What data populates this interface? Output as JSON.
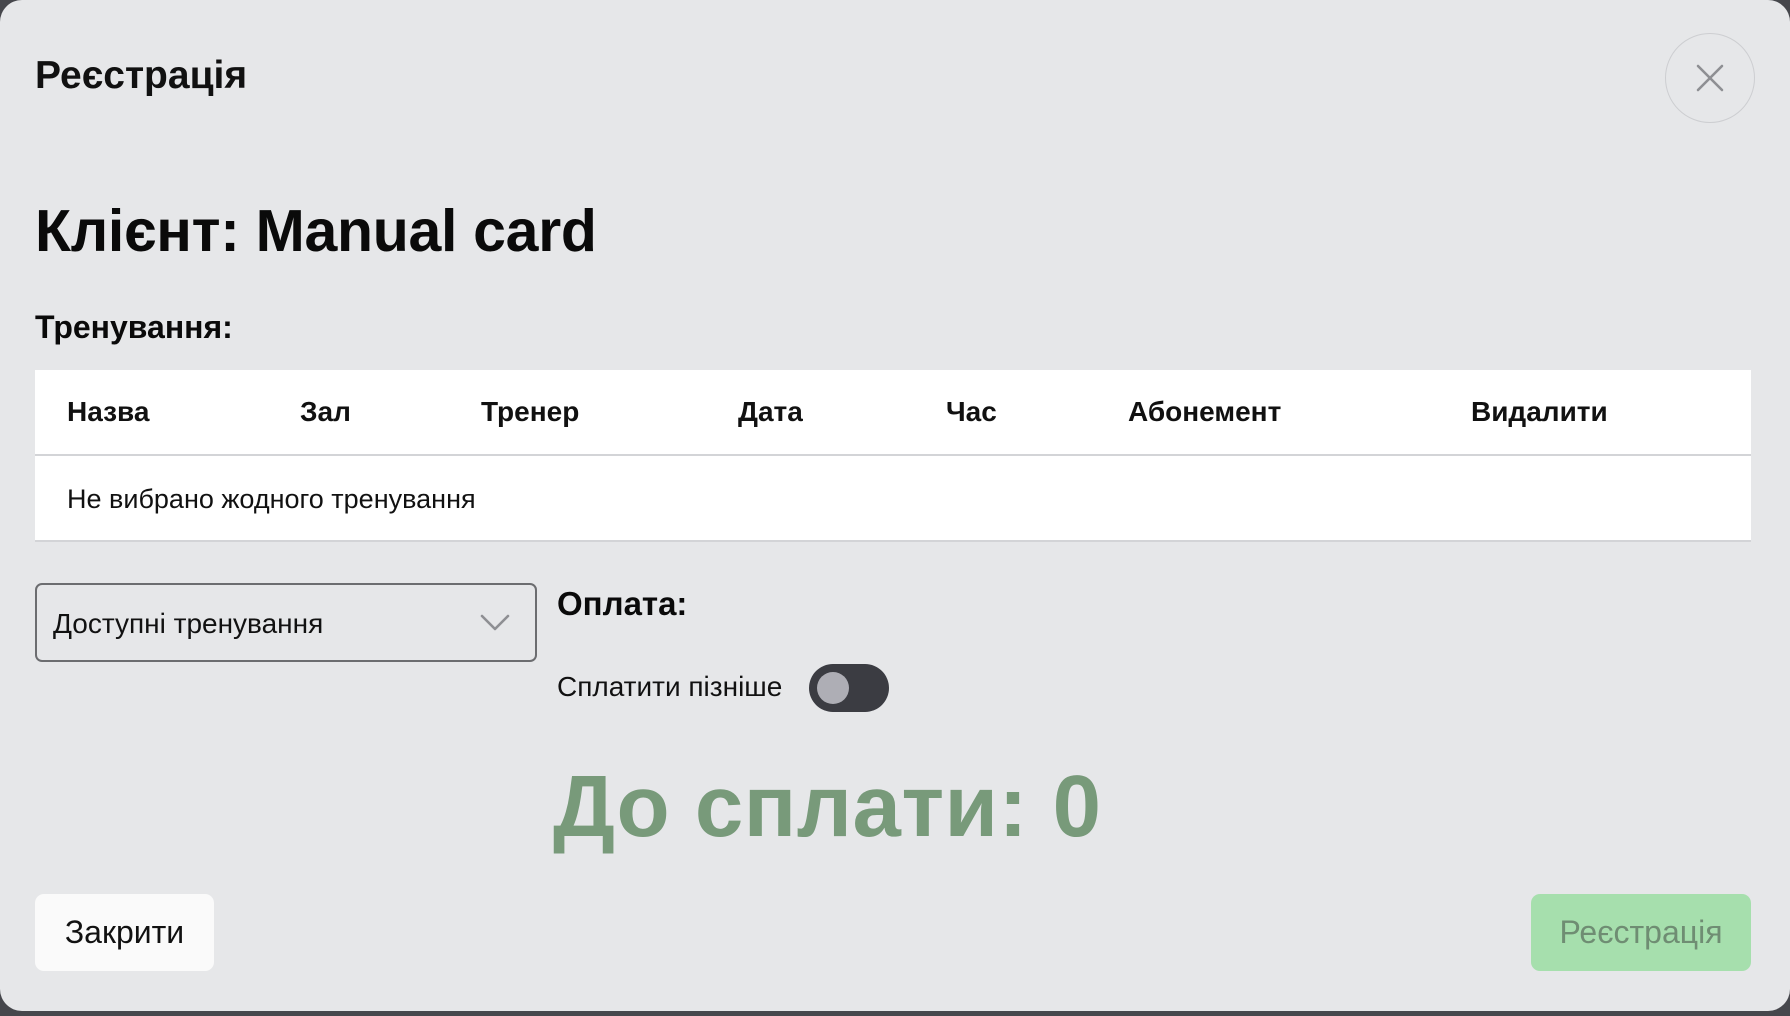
{
  "modal": {
    "title": "Реєстрація",
    "close_icon": "close-icon"
  },
  "client": {
    "heading": "Клієнт: Manual card"
  },
  "trainings": {
    "label": "Тренування:",
    "columns": [
      "Назва",
      "Зал",
      "Тренер",
      "Дата",
      "Час",
      "Абонемент",
      "Видалити"
    ],
    "empty_message": "Не вибрано жодного тренування"
  },
  "available_select": {
    "value": "Доступні тренування",
    "icon": "chevron-down-icon"
  },
  "payment": {
    "label": "Оплата:",
    "pay_later_label": "Сплатити пізніше",
    "pay_later_enabled": false,
    "total": "До сплати: 0",
    "total_color": "#789a7a"
  },
  "footer": {
    "close_label": "Закрити",
    "register_label": "Реєстрація",
    "register_color": "#a6dfad"
  }
}
